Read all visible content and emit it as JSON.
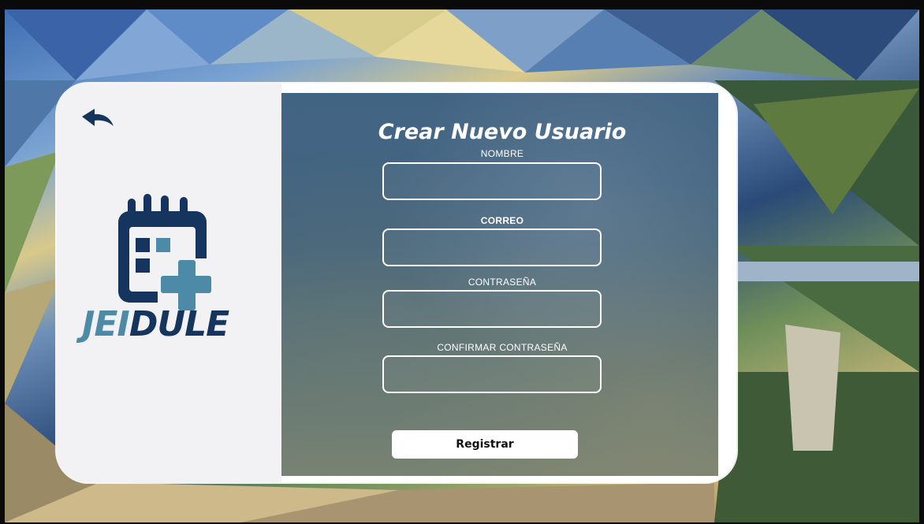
{
  "app": {
    "brand_left": "JEI",
    "brand_right": "DULE",
    "colors": {
      "brand_light": "#4c8aa8",
      "brand_dark": "#16355e",
      "panel_bg": "#f2f2f4",
      "form_overlay": "#34587a"
    }
  },
  "back": {
    "icon": "arrow-back-icon"
  },
  "logo": {
    "icon": "calendar-plus-icon"
  },
  "form": {
    "title": "Crear Nuevo Usuario",
    "fields": [
      {
        "label": "NOMBRE",
        "value": "",
        "placeholder": ""
      },
      {
        "label": "CORREO",
        "value": "",
        "placeholder": ""
      },
      {
        "label": "CONTRASEÑA",
        "value": "",
        "placeholder": ""
      },
      {
        "label": "CONFIRMAR CONTRASEÑA",
        "value": "",
        "placeholder": ""
      }
    ],
    "submit_label": "Registrar"
  }
}
